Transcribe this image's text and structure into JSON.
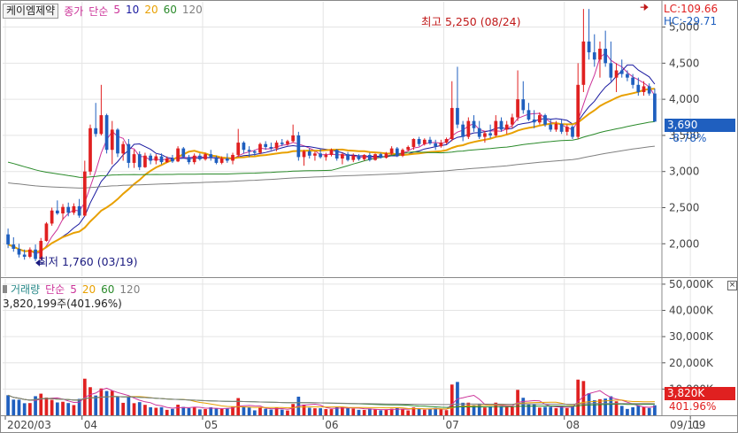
{
  "header": {
    "stock_name": "케이엠제약",
    "price_legend": [
      {
        "label": "종가",
        "color": "#cc3399"
      },
      {
        "label": "단순",
        "color": "#cc3399"
      },
      {
        "label": "5",
        "color": "#cc3399"
      },
      {
        "label": "10",
        "color": "#1a1aa0"
      },
      {
        "label": "20",
        "color": "#e8a000"
      },
      {
        "label": "60",
        "color": "#2a8a2a"
      },
      {
        "label": "120",
        "color": "#808080"
      }
    ],
    "lc_label": "LC:109.66",
    "hc_label": "HC:-29.71"
  },
  "volume_header": {
    "items": [
      {
        "label": "거래량",
        "color": "#2a8a8a"
      },
      {
        "label": "단순",
        "color": "#cc3399"
      },
      {
        "label": "5",
        "color": "#cc3399"
      },
      {
        "label": "20",
        "color": "#e8a000"
      },
      {
        "label": "60",
        "color": "#2a8a2a"
      },
      {
        "label": "120",
        "color": "#808080"
      }
    ],
    "current_volume": "3,820,199주(401.96%)"
  },
  "annotations": {
    "high": "최고 5,250 (08/24)",
    "low": "최저 1,760 (03/19)"
  },
  "price_badge": {
    "value": "3,690",
    "change": "-8.78%"
  },
  "volume_badge": {
    "value": "3,820K",
    "change": "401.96%"
  },
  "colors": {
    "up": "#e02020",
    "down": "#1f5fbf",
    "ma5": "#cc3399",
    "ma10": "#1a1aa0",
    "ma20": "#e8a000",
    "ma60": "#2a8a2a",
    "ma120": "#808080",
    "badge_blue": "#1f5fbf",
    "badge_red": "#e02020",
    "grid": "#e4e4e4"
  },
  "chart_data": [
    {
      "type": "candlestick",
      "title": "케이엠제약 종가 단순 5 10 20 60 120",
      "ylim": [
        1550,
        5350
      ],
      "y_ticks": [
        2000,
        2500,
        3000,
        3500,
        4000,
        4500,
        5000
      ],
      "y_tick_labels": [
        "2,000",
        "2,500",
        "3,000",
        "3,500",
        "4,000",
        "4,500",
        "5,000"
      ],
      "x_tick_labels": [
        "2020/03",
        "04",
        "05",
        "06",
        "07",
        "08",
        "09",
        "09/11"
      ],
      "x_tick_index": [
        0,
        14,
        36,
        58,
        80,
        102,
        125,
        142
      ],
      "last_close": 3690,
      "change_pct": -8.78,
      "high": {
        "value": 5250,
        "date": "08/24",
        "index": 117
      },
      "low": {
        "value": 1760,
        "date": "03/19",
        "index": 5
      },
      "candles": [
        [
          2130,
          2210,
          1940,
          1990
        ],
        [
          1990,
          2090,
          1890,
          1930
        ],
        [
          1930,
          2000,
          1810,
          1850
        ],
        [
          1850,
          1920,
          1780,
          1820
        ],
        [
          1820,
          1950,
          1800,
          1920
        ],
        [
          1920,
          1990,
          1760,
          1790
        ],
        [
          1790,
          2080,
          1780,
          2040
        ],
        [
          2040,
          2300,
          2030,
          2280
        ],
        [
          2280,
          2500,
          2250,
          2460
        ],
        [
          2460,
          2600,
          2400,
          2420
        ],
        [
          2420,
          2550,
          2330,
          2510
        ],
        [
          2510,
          2570,
          2380,
          2430
        ],
        [
          2430,
          2560,
          2400,
          2520
        ],
        [
          2520,
          2620,
          2360,
          2390
        ],
        [
          2390,
          3150,
          2380,
          3000
        ],
        [
          3000,
          3650,
          2950,
          3600
        ],
        [
          3600,
          3950,
          3480,
          3520
        ],
        [
          3520,
          4200,
          3500,
          3780
        ],
        [
          3780,
          3800,
          3250,
          3300
        ],
        [
          3300,
          3700,
          3100,
          3580
        ],
        [
          3580,
          3600,
          3200,
          3250
        ],
        [
          3250,
          3420,
          3150,
          3380
        ],
        [
          3380,
          3450,
          3050,
          3120
        ],
        [
          3120,
          3300,
          3050,
          3240
        ],
        [
          3240,
          3280,
          3020,
          3060
        ],
        [
          3060,
          3260,
          3050,
          3220
        ],
        [
          3220,
          3250,
          3100,
          3150
        ],
        [
          3150,
          3240,
          3100,
          3210
        ],
        [
          3210,
          3250,
          3100,
          3130
        ],
        [
          3130,
          3210,
          3120,
          3180
        ],
        [
          3180,
          3230,
          3120,
          3140
        ],
        [
          3140,
          3350,
          3130,
          3320
        ],
        [
          3320,
          3340,
          3180,
          3200
        ],
        [
          3200,
          3230,
          3100,
          3130
        ],
        [
          3130,
          3250,
          3100,
          3220
        ],
        [
          3220,
          3250,
          3150,
          3170
        ],
        [
          3170,
          3260,
          3150,
          3240
        ],
        [
          3240,
          3300,
          3150,
          3190
        ],
        [
          3190,
          3220,
          3100,
          3120
        ],
        [
          3120,
          3210,
          3100,
          3180
        ],
        [
          3180,
          3250,
          3120,
          3150
        ],
        [
          3150,
          3260,
          3100,
          3230
        ],
        [
          3230,
          3590,
          3200,
          3400
        ],
        [
          3400,
          3420,
          3250,
          3300
        ],
        [
          3300,
          3350,
          3200,
          3280
        ],
        [
          3280,
          3300,
          3220,
          3260
        ],
        [
          3260,
          3400,
          3240,
          3380
        ],
        [
          3380,
          3420,
          3300,
          3340
        ],
        [
          3340,
          3400,
          3300,
          3320
        ],
        [
          3320,
          3430,
          3280,
          3400
        ],
        [
          3400,
          3450,
          3350,
          3380
        ],
        [
          3380,
          3440,
          3360,
          3420
        ],
        [
          3420,
          3650,
          3400,
          3500
        ],
        [
          3500,
          3550,
          3150,
          3200
        ],
        [
          3200,
          3300,
          3080,
          3280
        ],
        [
          3280,
          3320,
          3180,
          3220
        ],
        [
          3220,
          3280,
          3150,
          3250
        ],
        [
          3250,
          3310,
          3180,
          3200
        ],
        [
          3200,
          3260,
          3150,
          3230
        ],
        [
          3230,
          3320,
          3210,
          3300
        ],
        [
          3300,
          3310,
          3150,
          3180
        ],
        [
          3180,
          3260,
          3100,
          3240
        ],
        [
          3240,
          3270,
          3140,
          3160
        ],
        [
          3160,
          3250,
          3130,
          3220
        ],
        [
          3220,
          3240,
          3150,
          3170
        ],
        [
          3170,
          3240,
          3150,
          3230
        ],
        [
          3230,
          3260,
          3140,
          3160
        ],
        [
          3160,
          3250,
          3150,
          3240
        ],
        [
          3240,
          3260,
          3180,
          3190
        ],
        [
          3190,
          3270,
          3180,
          3250
        ],
        [
          3250,
          3350,
          3230,
          3320
        ],
        [
          3320,
          3340,
          3200,
          3220
        ],
        [
          3220,
          3320,
          3200,
          3300
        ],
        [
          3300,
          3360,
          3280,
          3340
        ],
        [
          3340,
          3460,
          3300,
          3450
        ],
        [
          3450,
          3480,
          3350,
          3380
        ],
        [
          3380,
          3460,
          3360,
          3440
        ],
        [
          3440,
          3480,
          3370,
          3390
        ],
        [
          3390,
          3440,
          3300,
          3350
        ],
        [
          3350,
          3440,
          3330,
          3400
        ],
        [
          3400,
          3470,
          3380,
          3450
        ],
        [
          3450,
          4250,
          3420,
          3880
        ],
        [
          3880,
          4450,
          3600,
          3650
        ],
        [
          3650,
          3700,
          3420,
          3480
        ],
        [
          3480,
          3750,
          3450,
          3700
        ],
        [
          3700,
          3780,
          3550,
          3600
        ],
        [
          3600,
          3700,
          3450,
          3480
        ],
        [
          3480,
          3560,
          3400,
          3530
        ],
        [
          3530,
          3650,
          3460,
          3500
        ],
        [
          3500,
          3780,
          3480,
          3700
        ],
        [
          3700,
          3750,
          3550,
          3580
        ],
        [
          3580,
          3700,
          3520,
          3650
        ],
        [
          3650,
          3800,
          3600,
          3750
        ],
        [
          3750,
          4400,
          3700,
          4000
        ],
        [
          4000,
          4250,
          3800,
          3850
        ],
        [
          3850,
          3950,
          3700,
          3720
        ],
        [
          3720,
          3850,
          3600,
          3680
        ],
        [
          3680,
          3820,
          3650,
          3780
        ],
        [
          3780,
          3800,
          3620,
          3650
        ],
        [
          3650,
          3730,
          3550,
          3580
        ],
        [
          3580,
          3700,
          3550,
          3660
        ],
        [
          3660,
          3720,
          3520,
          3550
        ],
        [
          3550,
          3650,
          3500,
          3620
        ],
        [
          3620,
          3640,
          3450,
          3480
        ],
        [
          3480,
          4500,
          3450,
          4200
        ],
        [
          4200,
          5250,
          4100,
          4800
        ],
        [
          4800,
          5250,
          4550,
          4650
        ],
        [
          4650,
          4900,
          4450,
          4550
        ],
        [
          4550,
          4800,
          4300,
          4700
        ],
        [
          4700,
          4950,
          4450,
          4500
        ],
        [
          4500,
          4800,
          4250,
          4300
        ],
        [
          4300,
          4500,
          4100,
          4400
        ],
        [
          4400,
          4550,
          4300,
          4350
        ],
        [
          4350,
          4400,
          4250,
          4300
        ],
        [
          4300,
          4350,
          4150,
          4200
        ],
        [
          4200,
          4300,
          4050,
          4100
        ],
        [
          4100,
          4250,
          4050,
          4180
        ],
        [
          4180,
          4220,
          4050,
          4080
        ],
        [
          4080,
          4150,
          3800,
          3690
        ]
      ],
      "moving_averages": {
        "ma5_last": 4093,
        "ma10_last": 4228,
        "ma20_last": 4232,
        "ma60_last": 3771,
        "ma120_last": 3442
      }
    },
    {
      "type": "bar",
      "title": "거래량 단순 5 20 60 120",
      "unit": "K",
      "ylim": [
        0,
        52000
      ],
      "y_ticks": [
        10000,
        20000,
        30000,
        40000,
        50000
      ],
      "y_tick_labels": [
        "10,000K",
        "20,000K",
        "30,000K",
        "40,000K",
        "50,000K"
      ],
      "last_value": 3820,
      "last_change_pct": 401.96
    }
  ]
}
